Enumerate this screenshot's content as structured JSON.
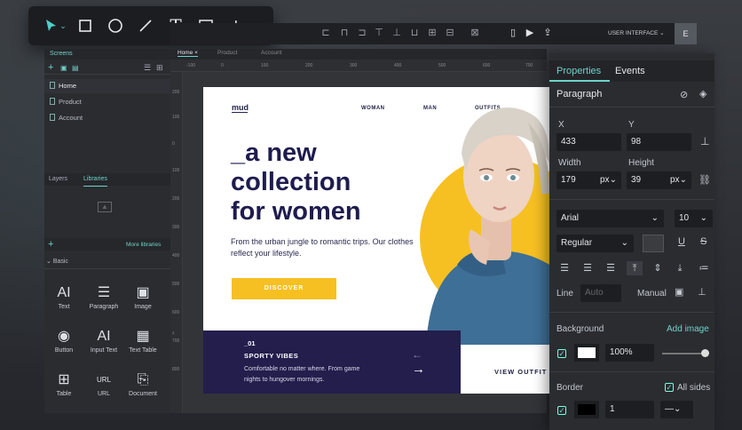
{
  "toolbar": {
    "tools": [
      "select-arrow-icon",
      "rectangle-icon",
      "ellipse-icon",
      "line-icon",
      "text-icon",
      "image-icon",
      "add-icon"
    ],
    "text_glyph": "T"
  },
  "topbar": {
    "user_interface": "USER INTERFACE",
    "avatar": "E"
  },
  "left_panel": {
    "screens_tab": "Screens",
    "screens": [
      "Home",
      "Product",
      "Account"
    ],
    "tabs": [
      "Layers",
      "Libraries"
    ],
    "more_libraries": "More libraries",
    "basic": "Basic",
    "components": [
      {
        "label": "Text",
        "glyph": "AI"
      },
      {
        "label": "Paragraph",
        "glyph": "☰"
      },
      {
        "label": "Image",
        "glyph": "▣"
      },
      {
        "label": "Button",
        "glyph": "◉"
      },
      {
        "label": "Input Text",
        "glyph": "AI"
      },
      {
        "label": "Text Table",
        "glyph": "▦"
      },
      {
        "label": "Table",
        "glyph": "⊞"
      },
      {
        "label": "URL",
        "glyph": "URL"
      },
      {
        "label": "Document",
        "glyph": "⎘"
      }
    ]
  },
  "canvas_tabs": [
    "Home",
    "Product",
    "Account"
  ],
  "ruler": {
    "h": [
      "-100",
      "0",
      "100",
      "200",
      "300",
      "400",
      "500",
      "600",
      "700"
    ],
    "v": [
      "200",
      "100",
      "0",
      "100",
      "200",
      "300",
      "400",
      "500",
      "600",
      "700",
      "800"
    ]
  },
  "page": {
    "logo": "mud",
    "nav": [
      "WOMAN",
      "MAN",
      "OUTFITS"
    ],
    "hero_lines": [
      "_a new",
      "collection",
      "for women"
    ],
    "subtitle": "From the urban jungle to romantic trips. Our clothes reflect your lifestyle.",
    "cta": "DISCOVER",
    "band_number": "_01",
    "band_title": "SPORTY VIBES",
    "band_text": "Comfortable no matter where. From game nights to hungover mornings.",
    "view_outfit": "VIEW OUTFIT"
  },
  "properties": {
    "tabs": [
      "Properties",
      "Events"
    ],
    "element": "Paragraph",
    "x_label": "X",
    "y_label": "Y",
    "x": "433",
    "y": "98",
    "w_label": "Width",
    "h_label": "Height",
    "width": "179",
    "height": "39",
    "unit": "px",
    "font": "Arial",
    "size": "10",
    "weight": "Regular",
    "line_label": "Line",
    "line_value": "Auto",
    "manual_label": "Manual",
    "background_label": "Background",
    "add_image": "Add image",
    "opacity": "100%",
    "border_label": "Border",
    "all_sides": "All sides",
    "border_width": "1",
    "accent": "#5fd3c7"
  }
}
